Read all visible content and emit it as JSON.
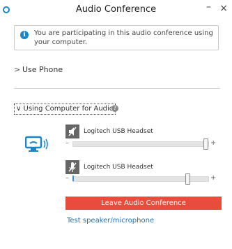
{
  "window": {
    "title": "Audio Conference",
    "app_icon": "circle-app-icon",
    "minimize_label": "–",
    "close_label": "×"
  },
  "info_banner": {
    "icon": "info-icon",
    "icon_glyph": "i",
    "text": "You are participating in this audio conference using your computer."
  },
  "use_phone": {
    "chevron": ">",
    "label": "Use Phone"
  },
  "computer_audio": {
    "chevron": "∨",
    "label": "Using Computer for Audio",
    "help_icon": "help-icon",
    "computer_icon": "computer-audio-icon",
    "devices": [
      {
        "icon": "speaker-icon",
        "label": "Logitech USB Headset",
        "volume_percent": 100
      },
      {
        "icon": "microphone-icon",
        "label": "Logitech USB Headset",
        "volume_percent": 86
      }
    ],
    "minus_label": "–",
    "plus_label": "+",
    "leave_button": "Leave Audio Conference",
    "test_link": "Test speaker/microphone"
  },
  "colors": {
    "accent_blue": "#1a86c8",
    "leave_red": "#e84c3d",
    "link_blue": "#1a73b8"
  }
}
